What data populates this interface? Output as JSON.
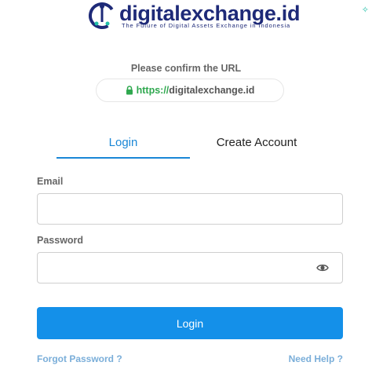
{
  "brand": {
    "name": "digitalexchange.id",
    "tagline": "The Future of Digital Assets Exchange in Indonesia",
    "primary_color": "#1e2a78",
    "accent_color": "#1490e9"
  },
  "url_confirm": {
    "label": "Please confirm the URL",
    "scheme": "https://",
    "host": "digitalexchange.id",
    "icon": "lock-icon"
  },
  "tabs": [
    {
      "label": "Login",
      "active": true
    },
    {
      "label": "Create Account",
      "active": false
    }
  ],
  "form": {
    "email": {
      "label": "Email",
      "value": "",
      "placeholder": ""
    },
    "password": {
      "label": "Password",
      "value": "",
      "placeholder": "",
      "icon": "eye-icon"
    },
    "submit_label": "Login"
  },
  "links": {
    "forgot": "Forgot Password ?",
    "help": "Need Help ?"
  }
}
